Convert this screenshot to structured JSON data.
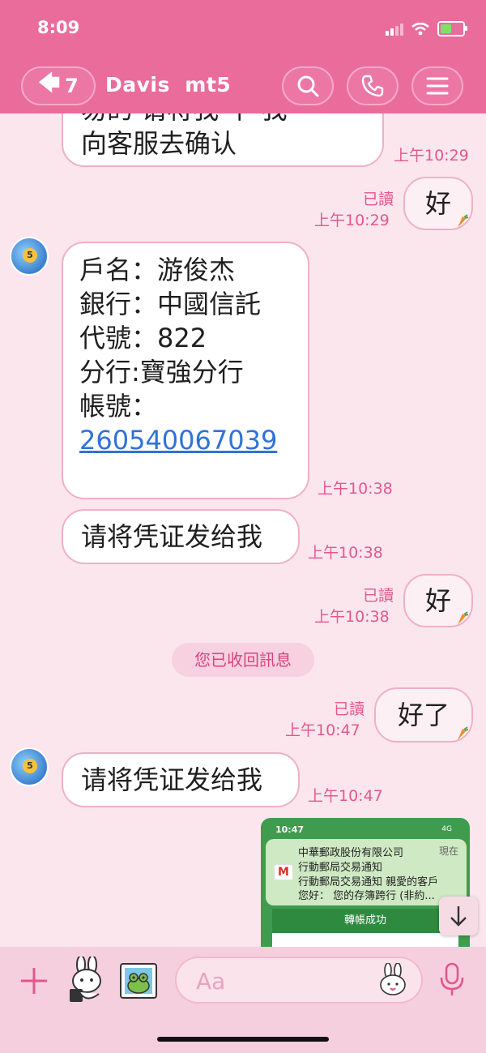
{
  "status_bar": {
    "time": "8:09"
  },
  "header": {
    "back_count": "7",
    "title": "Davis  mt5",
    "icons": [
      "back-arrow-icon",
      "search-icon",
      "phone-icon",
      "menu-icon"
    ]
  },
  "messages": {
    "m1": {
      "partial_line": "易的  请将我  下  我",
      "line2": "向客服去确认",
      "time": "上午10:29"
    },
    "m2": {
      "text": "好",
      "read": "已讀",
      "time": "上午10:29"
    },
    "m3": {
      "lines": [
        "戶名：游俊杰",
        "銀行：中國信託",
        "代號：822",
        "分行:寶強分行",
        "帳號："
      ],
      "account_link": "260540067039",
      "time": "上午10:38"
    },
    "m4": {
      "text": "请将凭证发给我",
      "time": "上午10:38"
    },
    "m5": {
      "text": "好",
      "read": "已讀",
      "time": "上午10:38"
    },
    "notice": "您已收回訊息",
    "m6": {
      "text": "好了",
      "read": "已讀",
      "time": "上午10:47"
    },
    "m7": {
      "text": "请将凭证发给我",
      "time": "上午10:47"
    }
  },
  "screenshot_thumb": {
    "time": "10:47",
    "signal": "4G",
    "sender": "中華郵政股份有限公司",
    "when": "現在",
    "subject": "行動郵局交易通知",
    "preview1": "行動郵局交易通知 親愛的客戶",
    "preview2": "您好： 您的存簿跨行 (非約...",
    "banner": "轉帳成功"
  },
  "composer": {
    "placeholder": "Aa"
  },
  "colors": {
    "header": "#ea6c9b",
    "background": "#fbe6ee",
    "accent_text": "#e2588c",
    "link": "#2f73d8"
  }
}
